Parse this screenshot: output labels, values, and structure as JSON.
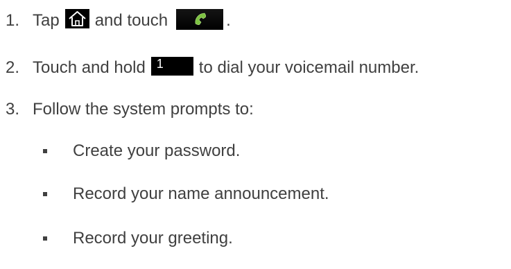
{
  "steps": [
    {
      "number": "1.",
      "text_before": "Tap",
      "text_middle": "and touch",
      "text_after": "."
    },
    {
      "number": "2.",
      "text_before": "Touch and hold",
      "key_label": "1",
      "text_after": "to dial your voicemail number."
    },
    {
      "number": "3.",
      "text": "Follow the system prompts to:"
    }
  ],
  "bullets": [
    "Create your password.",
    "Record your name announcement.",
    "Record your greeting."
  ],
  "icons": {
    "home": "home-icon",
    "phone": "phone-icon"
  },
  "colors": {
    "text": "#404040",
    "key_background": "#000000",
    "phone_green": "#7dc242",
    "home_outline": "#ffffff"
  }
}
